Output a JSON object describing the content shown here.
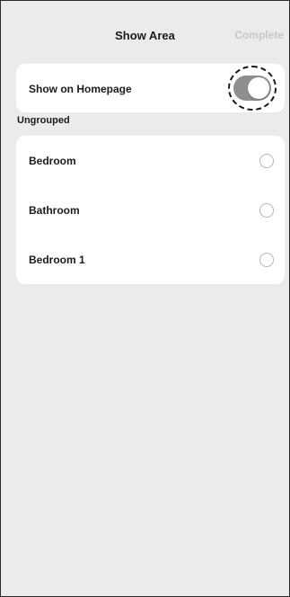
{
  "header": {
    "title": "Show Area",
    "complete_label": "Complete"
  },
  "homepage_setting": {
    "label": "Show on Homepage",
    "toggle_on": true
  },
  "section": {
    "label": "Ungrouped"
  },
  "rooms": [
    {
      "label": "Bedroom",
      "selected": false
    },
    {
      "label": "Bathroom",
      "selected": false
    },
    {
      "label": "Bedroom 1",
      "selected": false
    }
  ],
  "colors": {
    "background": "#ebebeb",
    "card": "#ffffff",
    "toggle_track": "#8e8e8e",
    "complete_text": "#c8c8c8"
  }
}
